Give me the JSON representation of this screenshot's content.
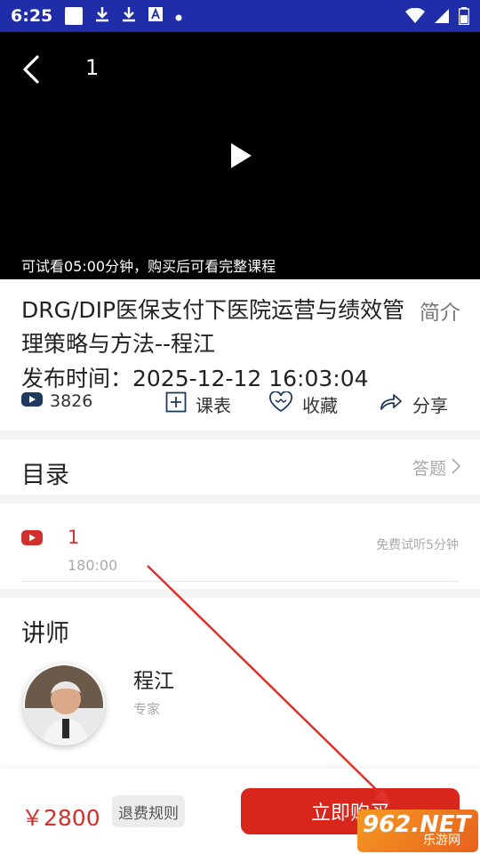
{
  "statusbar": {
    "time": "6:25"
  },
  "video": {
    "title": "1",
    "trial_notice": "可试看05:00分钟，购买后可看完整课程"
  },
  "course": {
    "title": "DRG/DIP医保支付下医院运营与绩效管理策略与方法--程江",
    "intro_label": "简介",
    "publish_time": "发布时间：2025-12-12 16:03:04",
    "views": "3826",
    "actions": {
      "schedule": "课表",
      "favorite": "收藏",
      "share": "分享"
    }
  },
  "catalog": {
    "heading": "目录",
    "answer_link": "答题",
    "lessons": [
      {
        "index": "1",
        "duration": "180:00",
        "free_label": "免费试听5分钟"
      }
    ]
  },
  "teacher": {
    "heading": "讲师",
    "name": "程江",
    "role": "专家"
  },
  "bottom": {
    "price": "￥2800",
    "refund_label": "退费规则",
    "buy_label": "立即购买"
  },
  "watermark": {
    "big": "962.NET",
    "small": "乐游网"
  },
  "colors": {
    "accent_red": "#d9261c",
    "statusbar_blue": "#1f2ea8"
  }
}
